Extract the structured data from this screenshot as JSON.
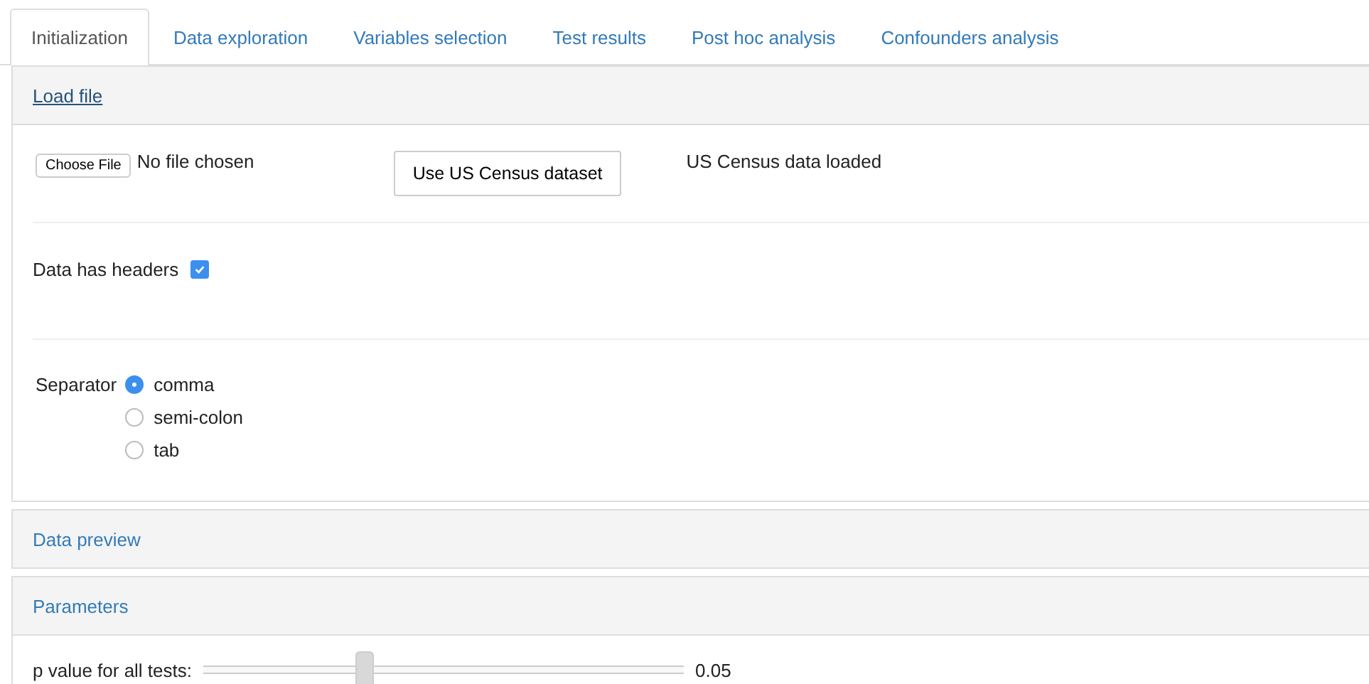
{
  "tabs": [
    {
      "label": "Initialization",
      "selected": true
    },
    {
      "label": "Data exploration",
      "selected": false
    },
    {
      "label": "Variables selection",
      "selected": false
    },
    {
      "label": "Test results",
      "selected": false
    },
    {
      "label": "Post hoc analysis",
      "selected": false
    },
    {
      "label": "Confounders analysis",
      "selected": false
    }
  ],
  "load_file": {
    "title": "Load file",
    "file_button": "Choose File",
    "file_status": "No file chosen",
    "dataset_button": "Use US Census dataset",
    "status": "US Census data loaded",
    "headers": {
      "label": "Data has headers",
      "checked": true
    },
    "separator": {
      "label": "Separator",
      "options": [
        {
          "label": "comma",
          "selected": true
        },
        {
          "label": "semi-colon",
          "selected": false
        },
        {
          "label": "tab",
          "selected": false
        }
      ]
    }
  },
  "data_preview": {
    "title": "Data preview"
  },
  "parameters": {
    "title": "Parameters",
    "slider": {
      "label": "p value for all tests:",
      "level": 0.335,
      "reading": "0.05"
    }
  }
}
